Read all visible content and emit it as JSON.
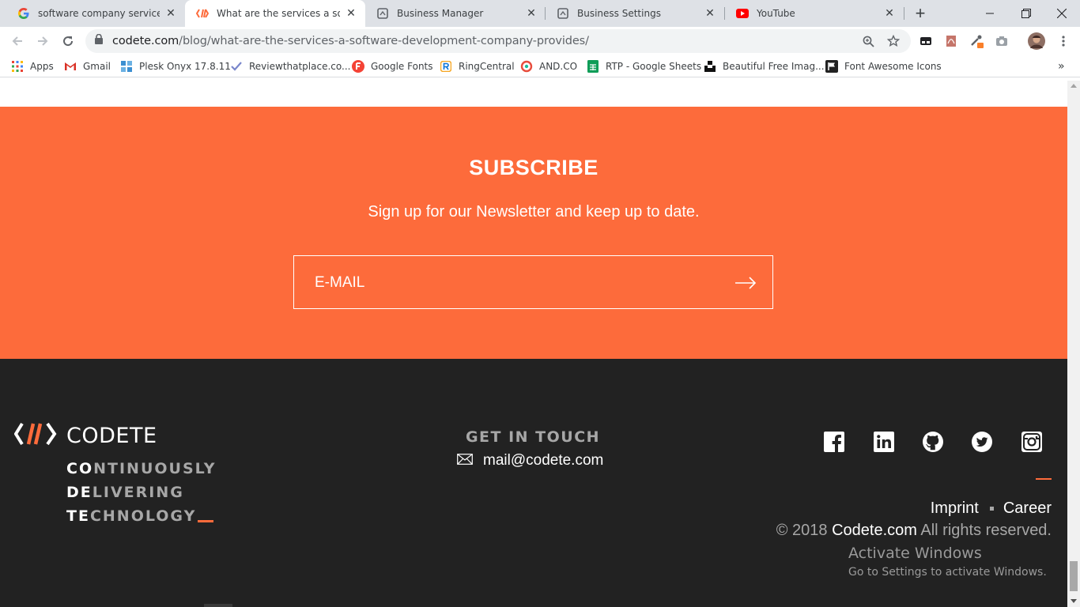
{
  "browser": {
    "tabs": [
      {
        "title": "software company services - G",
        "favicon": "google-g-icon",
        "active": false
      },
      {
        "title": "What are the services a softwa",
        "favicon": "codete-icon",
        "active": true
      },
      {
        "title": "Business Manager",
        "favicon": "business-manager-icon",
        "active": false
      },
      {
        "title": "Business Settings",
        "favicon": "business-manager-icon",
        "active": false
      },
      {
        "title": "YouTube",
        "favicon": "youtube-icon",
        "active": false
      }
    ],
    "url_domain": "codete.com",
    "url_path": "/blog/what-are-the-services-a-software-development-company-provides/",
    "bookmarks": [
      {
        "label": "Apps",
        "icon": "apps-grid-icon"
      },
      {
        "label": "Gmail",
        "icon": "gmail-icon"
      },
      {
        "label": "Plesk Onyx 17.8.11",
        "icon": "plesk-icon"
      },
      {
        "label": "Reviewthatplace.co...",
        "icon": "check-icon"
      },
      {
        "label": "Google Fonts",
        "icon": "google-fonts-icon"
      },
      {
        "label": "RingCentral",
        "icon": "ringcentral-icon"
      },
      {
        "label": "AND.CO",
        "icon": "andco-icon"
      },
      {
        "label": "RTP - Google Sheets",
        "icon": "sheets-icon"
      },
      {
        "label": "Beautiful Free Imag...",
        "icon": "unsplash-icon"
      },
      {
        "label": "Font Awesome Icons",
        "icon": "flag-icon"
      }
    ],
    "overflow_label": "»"
  },
  "subscribe": {
    "title": "SUBSCRIBE",
    "text": "Sign up for our Newsletter and keep up to date.",
    "email_placeholder": "E-MAIL",
    "email_value": ""
  },
  "footer": {
    "logo_text": "CODETE",
    "tagline": [
      {
        "bold": "CO",
        "rest": "NTINUOUSLY"
      },
      {
        "bold": "DE",
        "rest": "LIVERING"
      },
      {
        "bold": "TE",
        "rest": "CHNOLOGY"
      }
    ],
    "contact_title": "GET IN TOUCH",
    "email": "mail@codete.com",
    "social": [
      "facebook-icon",
      "linkedin-icon",
      "github-icon",
      "twitter-icon",
      "instagram-icon"
    ],
    "links": [
      "Imprint",
      "Career"
    ],
    "copyright_prefix": "© 2018",
    "copyright_brand": "Codete.com",
    "copyright_suffix": "All rights reserved.",
    "accent_color": "#fd6b3b"
  },
  "watermark": {
    "title": "Activate Windows",
    "subtitle": "Go to Settings to activate Windows."
  }
}
